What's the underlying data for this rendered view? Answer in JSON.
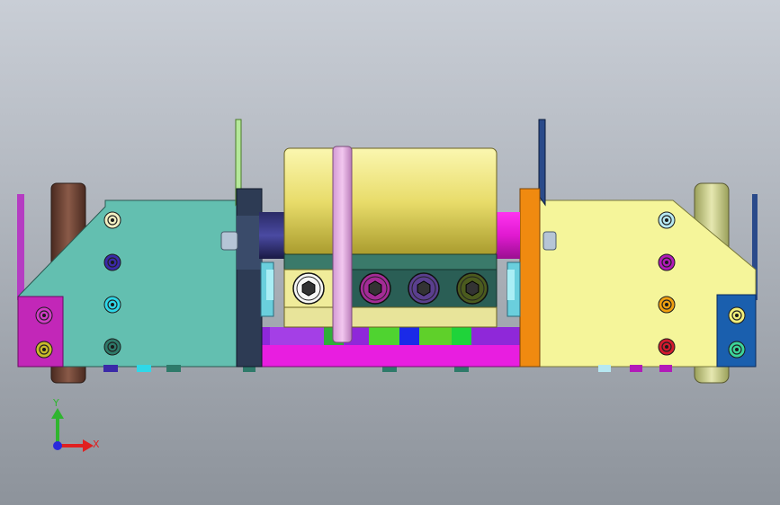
{
  "viewport": {
    "background_top": "#c9ced6",
    "background_bottom": "#8d939b"
  },
  "triad": {
    "x_label": "X",
    "y_label": "Y",
    "x_color": "#e02020",
    "y_color": "#2fb52f",
    "origin_color": "#2a2adc"
  },
  "parts": {
    "left_plate_color": "#63bfb0",
    "right_plate_color": "#f5f59a",
    "roller_color": "#f2ec93",
    "base_bar_color": "#e81ee0",
    "flange_left_color": "#2d3b54",
    "flange_right_color": "#f08a10",
    "left_end_block_color": "#c227b8",
    "right_end_block_color": "#1a5fae",
    "left_wheel_color": "#7a4a3c",
    "right_wheel_color": "#d5d79a"
  },
  "bolts": [
    {
      "name": "bolt-left-1",
      "color": "#f2f0c2"
    },
    {
      "name": "bolt-left-2",
      "color": "#3a2aa8"
    },
    {
      "name": "bolt-left-3",
      "color": "#2fd8e8"
    },
    {
      "name": "bolt-left-4",
      "color": "#2e7a6a"
    },
    {
      "name": "bolt-right-1",
      "color": "#b6e8f2"
    },
    {
      "name": "bolt-right-2",
      "color": "#b21ab9"
    },
    {
      "name": "bolt-right-3",
      "color": "#f0a010"
    },
    {
      "name": "bolt-right-4",
      "color": "#d21a2e"
    },
    {
      "name": "bolt-end-left-1",
      "color": "#d13cc7"
    },
    {
      "name": "bolt-end-left-2",
      "color": "#c8ba2a"
    },
    {
      "name": "bolt-end-right-1",
      "color": "#f0ee7a"
    },
    {
      "name": "bolt-end-right-2",
      "color": "#3cd49a"
    }
  ],
  "hex_sockets": [
    {
      "name": "hex-socket-1",
      "color": "#f7f7f5"
    },
    {
      "name": "hex-socket-2",
      "color": "#a42b96"
    },
    {
      "name": "hex-socket-3",
      "color": "#5a3f8e"
    },
    {
      "name": "hex-socket-4",
      "color": "#4b5b1e"
    }
  ]
}
